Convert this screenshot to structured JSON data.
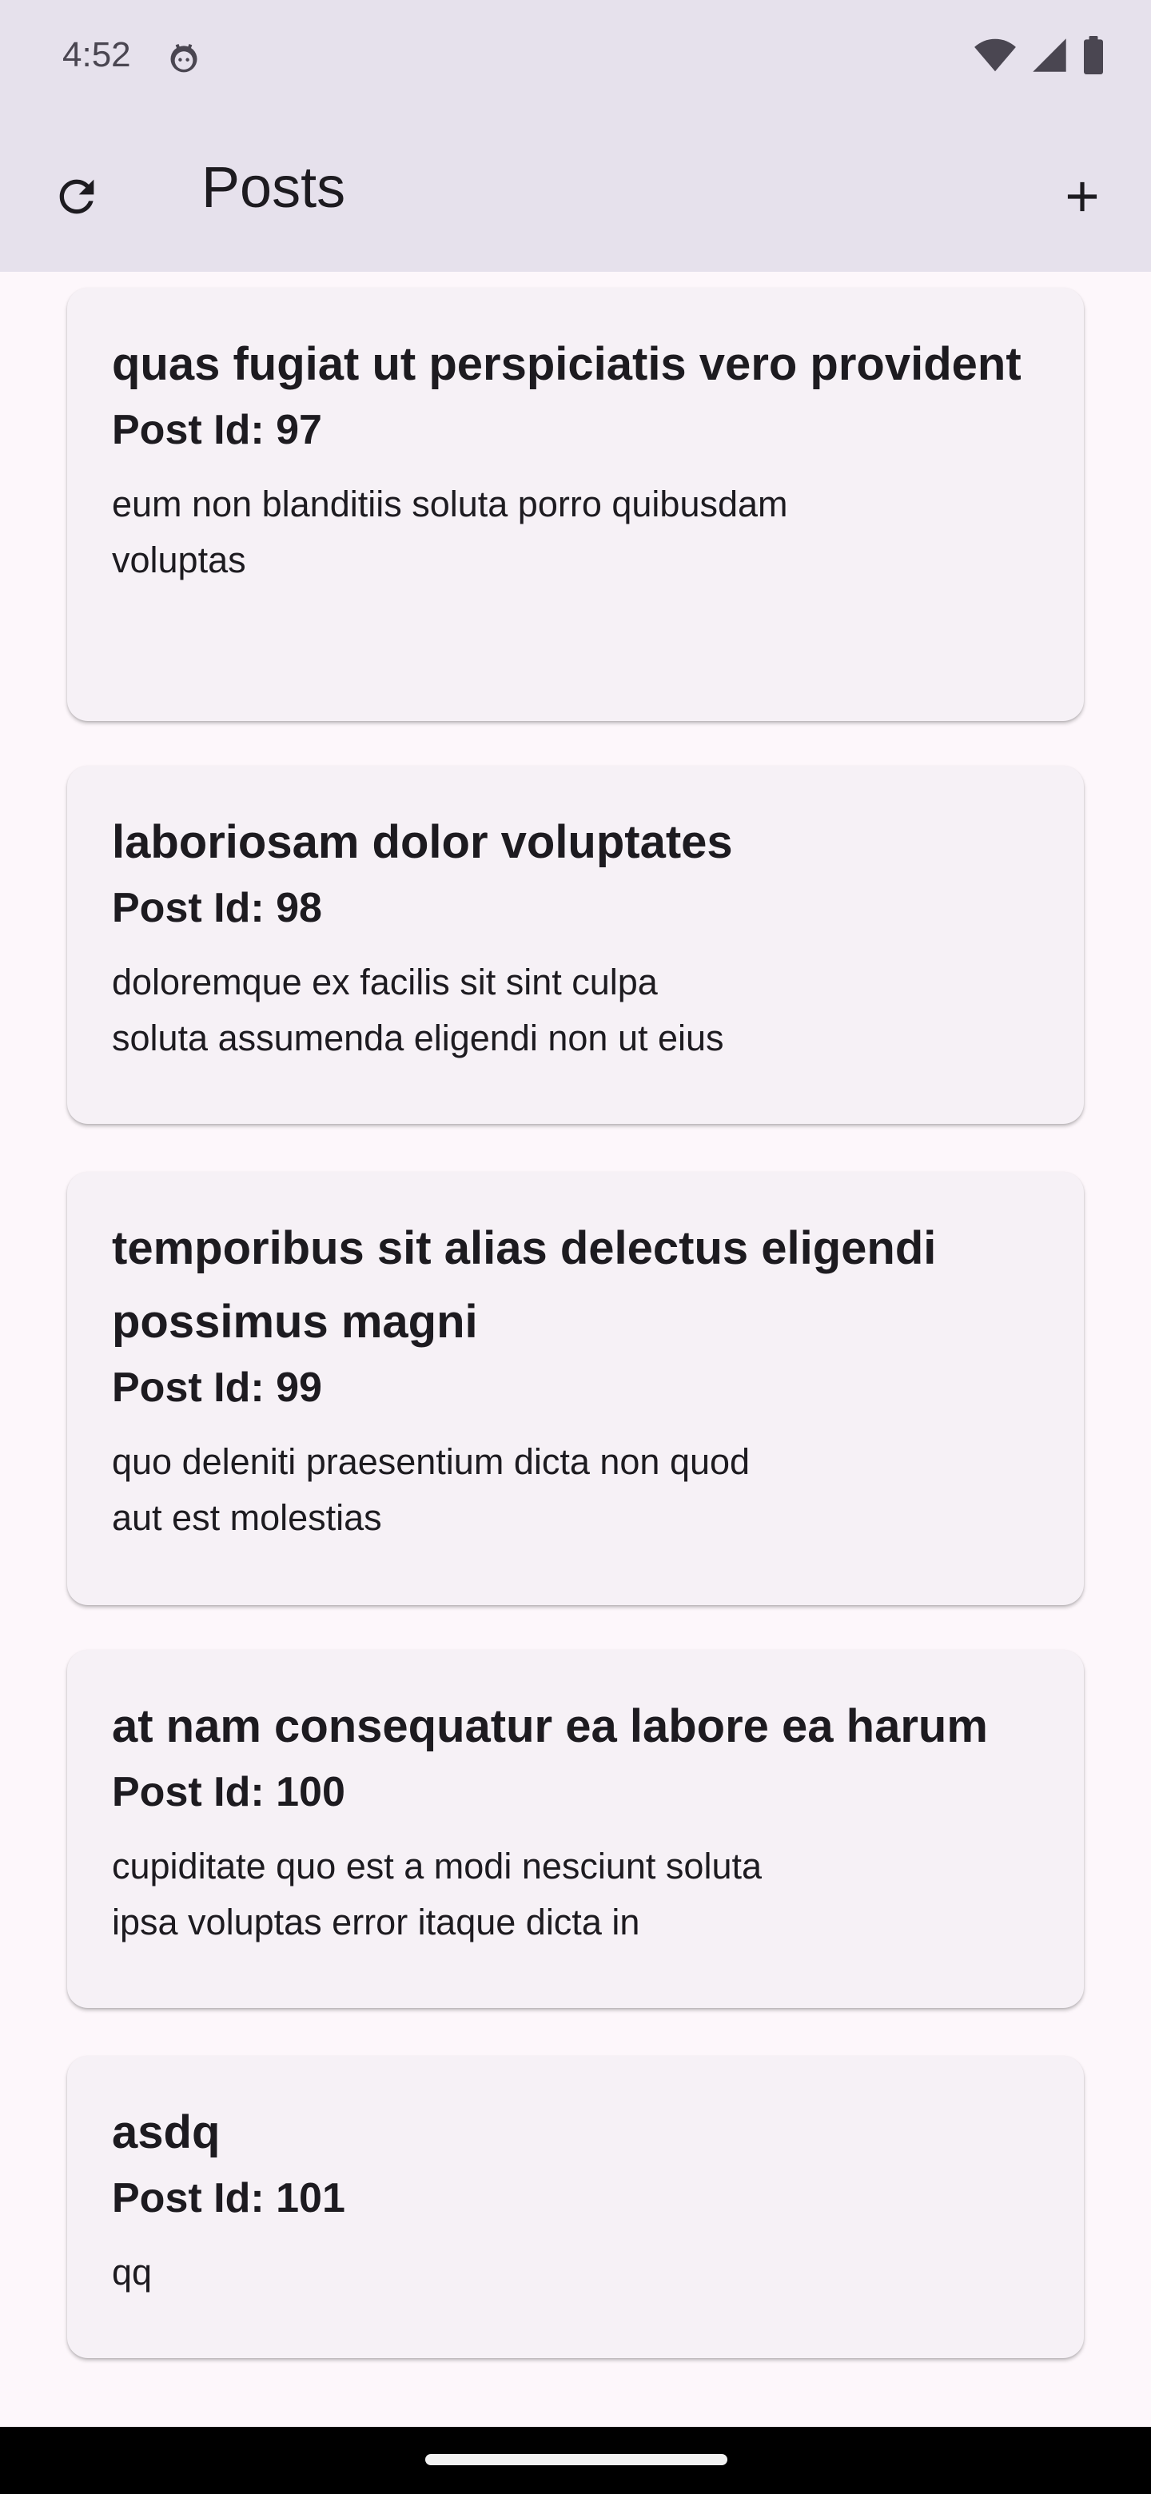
{
  "status_bar": {
    "time": "4:52",
    "icons": [
      "android-face-icon",
      "wifi-icon",
      "signal-icon",
      "battery-icon"
    ]
  },
  "app_bar": {
    "title": "Posts",
    "refresh_icon": "refresh-icon",
    "add_icon": "add-icon"
  },
  "posts": [
    {
      "title": "quas fugiat ut perspiciatis vero provident",
      "id_label": "Post Id: 97",
      "body": "eum non blanditiis soluta porro quibusdam\nvoluptas"
    },
    {
      "title": "laboriosam dolor voluptates",
      "id_label": "Post Id: 98",
      "body": "doloremque ex facilis sit sint culpa\nsoluta assumenda eligendi non ut eius"
    },
    {
      "title": "temporibus sit alias delectus eligendi possimus magni",
      "id_label": "Post Id: 99",
      "body": "quo deleniti praesentium dicta non quod\naut est molestias"
    },
    {
      "title": "at nam consequatur ea labore ea harum",
      "id_label": "Post Id: 100",
      "body": "cupiditate quo est a modi nesciunt soluta\nipsa voluptas error itaque dicta in"
    },
    {
      "title": "asdq",
      "id_label": "Post Id: 101",
      "body": "qq"
    }
  ],
  "colors": {
    "app_bar_bg": "#e6e1ec",
    "page_bg": "#fdf7fb",
    "card_bg": "#f6f1f6",
    "text": "#1d1b20"
  }
}
